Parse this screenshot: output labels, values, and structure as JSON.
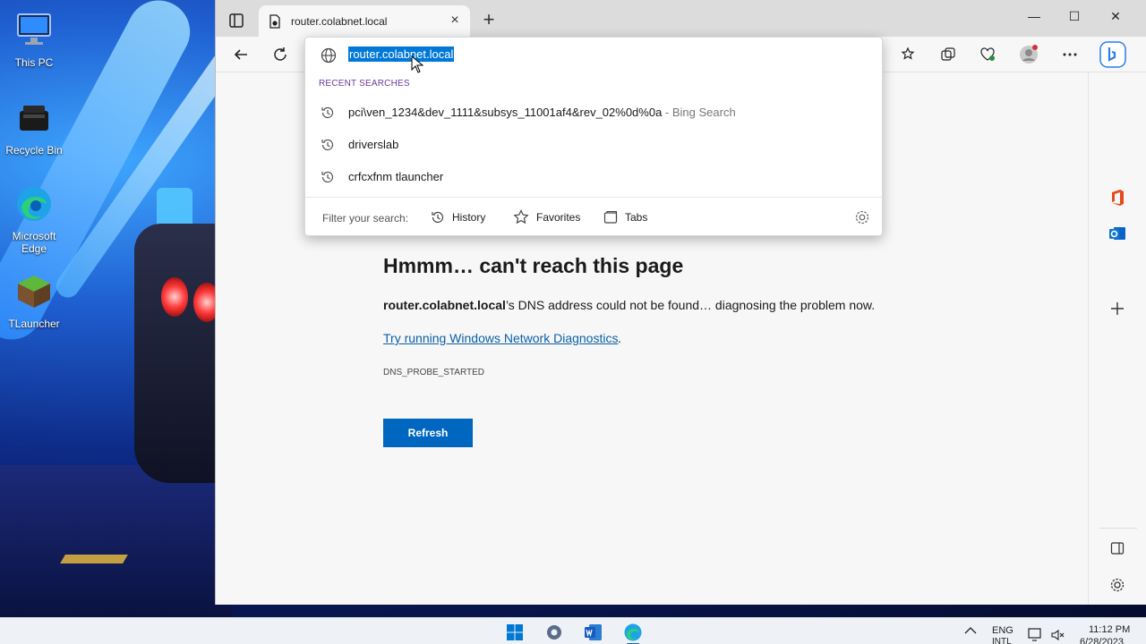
{
  "desktop": {
    "icons": [
      {
        "label": "This PC"
      },
      {
        "label": "Recycle Bin"
      },
      {
        "label": "Microsoft Edge"
      },
      {
        "label": "TLauncher"
      }
    ]
  },
  "browser": {
    "tab": {
      "title": "router.colabnet.local",
      "close": "×"
    },
    "new_tab": "+",
    "window_controls": {
      "minimize": "—",
      "maximize": "☐",
      "close": "✕"
    },
    "address": {
      "value": "router.colabnet.local"
    },
    "dropdown": {
      "recent_header": "RECENT SEARCHES",
      "suggestions": [
        {
          "text": "pci\\ven_1234&dev_1111&subsys_11001af4&rev_02%0d%0a",
          "suffix": " - Bing Search"
        },
        {
          "text": "driverslab",
          "suffix": ""
        },
        {
          "text": "crfcxfnm tlauncher",
          "suffix": ""
        }
      ],
      "filter": {
        "label": "Filter your search:",
        "history": "History",
        "favorites": "Favorites",
        "tabs": "Tabs"
      }
    },
    "error": {
      "title": "Hmmm… can't reach this page",
      "host": "router.colabnet.local",
      "desc_rest": "’s DNS address could not be found… diagnosing the problem now.",
      "link": "Try running Windows Network Diagnostics",
      "link_period": ".",
      "code": "DNS_PROBE_STARTED",
      "refresh": "Refresh"
    }
  },
  "taskbar": {
    "lang_line1": "ENG",
    "lang_line2": "INTL",
    "time": "11:12 PM",
    "date": "6/28/2023"
  },
  "colors": {
    "accent": "#0067c0",
    "selection": "#0078d7",
    "link": "#0c5fa8",
    "recent_header": "#6b3a9b"
  }
}
